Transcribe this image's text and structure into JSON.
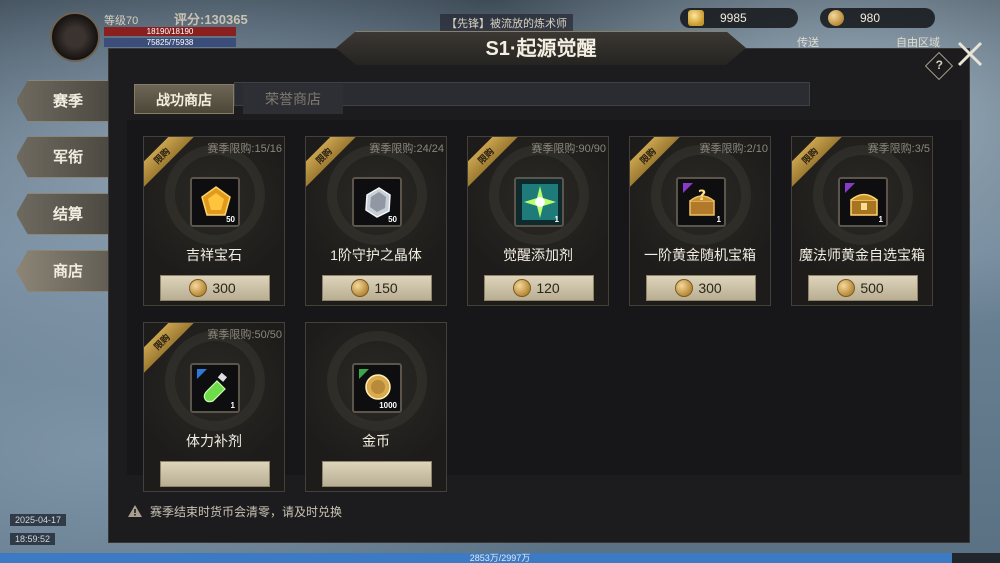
{
  "hud": {
    "level": "等级70",
    "score": "评分:130365",
    "hp": "18190/18190",
    "mp": "75825/75938",
    "notice": "【先锋】被流放的炼术师",
    "gold_amount": "9985",
    "coin_amount": "980",
    "send_label": "传送",
    "area_label": "自由区域",
    "date": "2025-04-17",
    "time": "18:59:52",
    "exp_label": "2853万/2997万",
    "exp_progress": 0.952
  },
  "nav": {
    "items": [
      {
        "label": "赛季"
      },
      {
        "label": "军衔"
      },
      {
        "label": "结算"
      },
      {
        "label": "商店"
      }
    ],
    "active_index": 3
  },
  "panel": {
    "title": "S1·起源觉醒",
    "help_label": "?"
  },
  "tabs": [
    {
      "label": "战功商店",
      "active": true
    },
    {
      "label": "荣誉商店",
      "active": false
    }
  ],
  "items": [
    {
      "name": "吉祥宝石",
      "limit": "赛季限购:15/16",
      "qty": "50",
      "price": "300",
      "ribbon": "限购",
      "icon": "gem-icon"
    },
    {
      "name": "1阶守护之晶体",
      "limit": "赛季限购:24/24",
      "qty": "50",
      "price": "150",
      "ribbon": "限购",
      "icon": "crystal-icon"
    },
    {
      "name": "觉醒添加剂",
      "limit": "赛季限购:90/90",
      "qty": "1",
      "price": "120",
      "ribbon": "限购",
      "icon": "burst-icon"
    },
    {
      "name": "一阶黄金随机宝箱",
      "limit": "赛季限购:2/10",
      "qty": "1",
      "price": "300",
      "ribbon": "限购",
      "icon": "mystery-chest-icon"
    },
    {
      "name": "魔法师黄金自选宝箱",
      "limit": "赛季限购:3/5",
      "qty": "1",
      "price": "500",
      "ribbon": "限购",
      "icon": "gold-chest-icon"
    },
    {
      "name": "体力补剂",
      "limit": "赛季限购:50/50",
      "qty": "1",
      "price": "",
      "ribbon": "限购",
      "icon": "potion-icon"
    },
    {
      "name": "金币",
      "limit": "",
      "qty": "1000",
      "price": "",
      "ribbon": "",
      "icon": "gold-coin-icon"
    }
  ],
  "footer": {
    "note": "赛季结束时货币会清零，请及时兑换"
  },
  "colors": {
    "accent_gold": "#c9a34f",
    "panel_bg": "#1c1c1e",
    "button_bg": "#ddd4bb"
  }
}
